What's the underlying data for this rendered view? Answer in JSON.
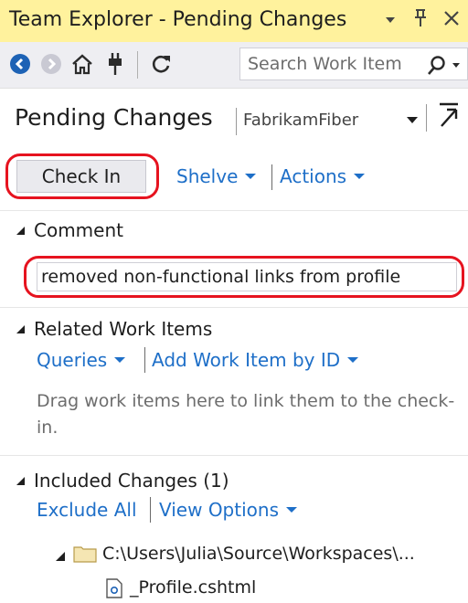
{
  "window": {
    "title": "Team Explorer - Pending Changes",
    "dropdown_icon": "dropdown-arrow-icon",
    "pin_icon": "pin-icon",
    "close_icon": "close-icon"
  },
  "toolbar": {
    "icons": [
      "back-arrow-icon",
      "forward-arrow-icon",
      "home-icon",
      "connect-icon",
      "refresh-icon"
    ],
    "search_placeholder": "Search Work Item",
    "search_icon": "search-icon"
  },
  "header": {
    "page_title": "Pending Changes",
    "project": "FabrikamFiber"
  },
  "actions": {
    "check_in_label": "Check In",
    "shelve_label": "Shelve",
    "actions_label": "Actions"
  },
  "comment": {
    "section_title": "Comment",
    "text": "removed non-functional links from profile"
  },
  "related_work_items": {
    "section_title": "Related Work Items",
    "queries_label": "Queries",
    "add_by_id_label": "Add Work Item by ID",
    "hint": "Drag work items here to link them to the check-in."
  },
  "included_changes": {
    "section_title": "Included Changes (1)",
    "exclude_all_label": "Exclude All",
    "view_options_label": "View Options",
    "folder_path": "C:\\Users\\Julia\\Source\\Workspaces\\...",
    "file_name": "_Profile.cshtml"
  },
  "colors": {
    "title_bar": "#fff29d",
    "link": "#1e6fc8",
    "highlight_ring": "#e6131f"
  }
}
